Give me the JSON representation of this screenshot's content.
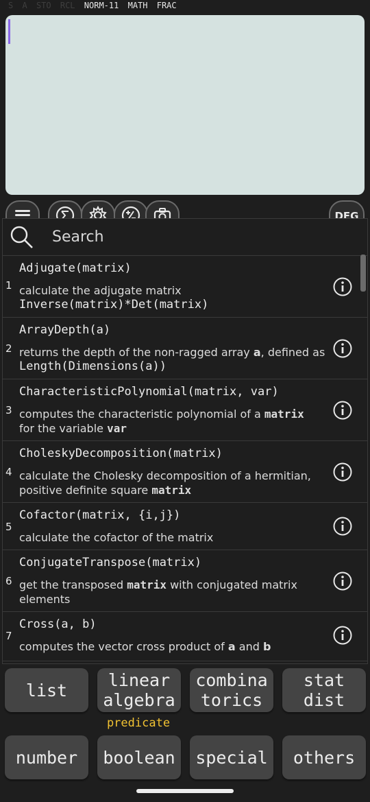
{
  "status": {
    "indicators_dim": [
      "S",
      "A",
      "STO",
      "RCL"
    ],
    "indicators_on": [
      "NORM-11",
      "MATH",
      "FRAC"
    ]
  },
  "toolbar": {
    "icons": [
      "menu-icon",
      "sigma-icon",
      "gear-icon",
      "plus-minus-icon",
      "camera-icon"
    ],
    "angle_mode": "DEG"
  },
  "search": {
    "placeholder": "Search"
  },
  "functions": [
    {
      "num": "1",
      "signature": "Adjugate(matrix)",
      "desc": "calculate the adjugate matrix",
      "code": "Inverse(matrix)*Det(matrix)"
    },
    {
      "num": "2",
      "signature": "ArrayDepth(a)",
      "desc_pre": "returns the depth of the non-ragged array ",
      "desc_bold": "a",
      "desc_post": ", defined as",
      "code": "Length(Dimensions(a))"
    },
    {
      "num": "3",
      "signature": "CharacteristicPolynomial(matrix, var)",
      "desc_pre": "computes the characteristic polynomial of a ",
      "desc_bold": "matrix",
      "desc_line2_pre": "for the variable ",
      "desc_line2_bold": "var"
    },
    {
      "num": "4",
      "signature": "CholeskyDecomposition(matrix)",
      "desc_pre": "calculate the Cholesky decomposition of a hermitian,",
      "desc_line2_pre": "positive definite square ",
      "desc_line2_bold": "matrix"
    },
    {
      "num": "5",
      "signature": "Cofactor(matrix, {i,j})",
      "desc": "calculate the cofactor of the matrix"
    },
    {
      "num": "6",
      "signature": "ConjugateTranspose(matrix)",
      "desc_pre": "get the transposed ",
      "desc_bold": "matrix",
      "desc_post": " with conjugated matrix",
      "desc_line2_pre": "elements"
    },
    {
      "num": "7",
      "signature": "Cross(a, b)",
      "desc_pre": "computes the vector cross product of ",
      "desc_bold": "a",
      "desc_mid": " and ",
      "desc_bold2": "b"
    }
  ],
  "categories": {
    "row1": [
      [
        "list"
      ],
      [
        "linear",
        "algebra"
      ],
      [
        "combina",
        "torics"
      ],
      [
        "stat",
        "dist"
      ]
    ],
    "predicate_label": "predicate",
    "row2": [
      [
        "number"
      ],
      [
        "boolean"
      ],
      [
        "special"
      ],
      [
        "others"
      ]
    ]
  },
  "colors": {
    "display_bg": "#d5e2e0",
    "cursor": "#8a67e8",
    "predicate": "#f1c232",
    "button_bg": "#444444"
  }
}
